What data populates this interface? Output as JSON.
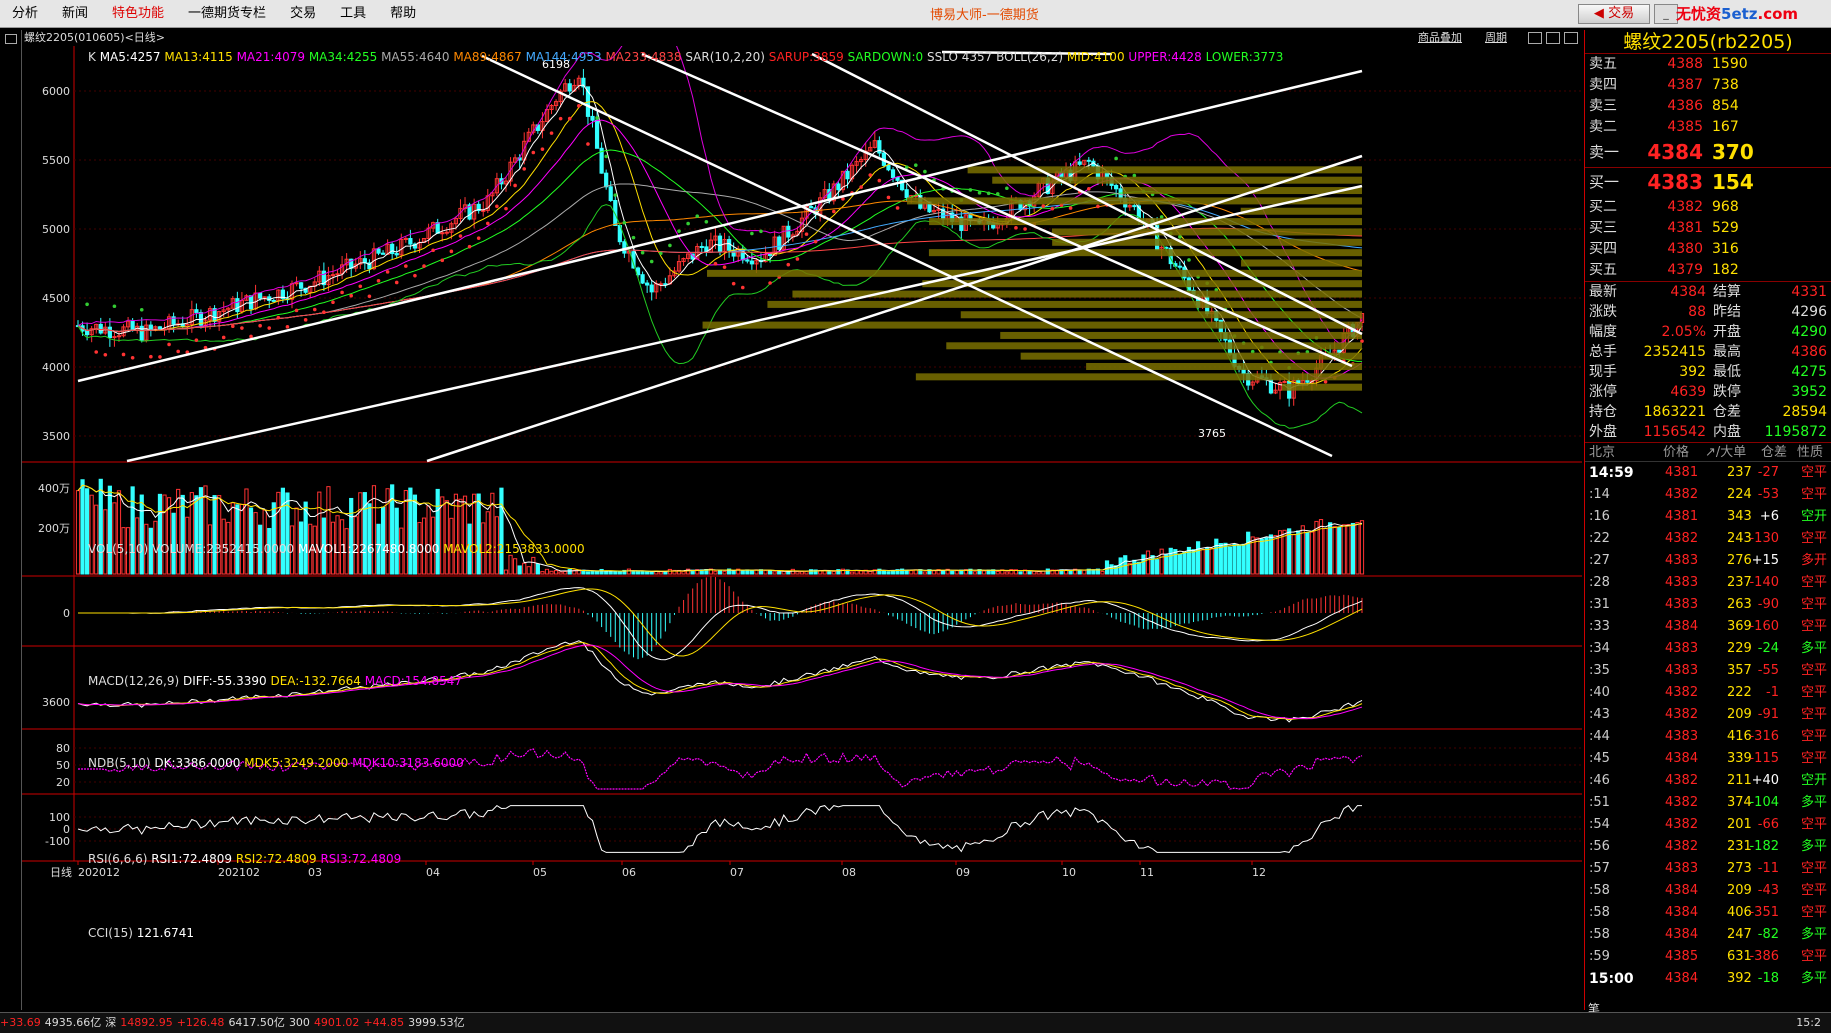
{
  "menu": {
    "items": [
      "分析",
      "新闻",
      "特色功能",
      "一德期货专栏",
      "交易",
      "工具",
      "帮助"
    ],
    "active_index": 2,
    "title": "博易大师-一德期货",
    "trade_button": "交易",
    "logo_red": "无忧资",
    "logo_blue": "5etz",
    "logo_tail": ".com"
  },
  "chart_header": {
    "symbol": "螺纹2205(010605)<日线>",
    "overlay_btn": "商品叠加",
    "period_btn": "周期"
  },
  "main_indicators": {
    "k": "K",
    "ma5": "MA5:4257",
    "ma13": "MA13:4115",
    "ma21": "MA21:4079",
    "ma34": "MA34:4255",
    "ma55": "MA55:4640",
    "ma89": "MA89:4867",
    "ma144": "MA144:4953",
    "ma233": "MA233:4838",
    "sar": "SAR(10,2,20)",
    "sarup": "SARUP:3859",
    "sardown": "SARDOWN:0",
    "sslo": "SSLO 4357",
    "boll": "BOLL(26,2)",
    "mid": "MID:4100",
    "upper": "UPPER:4428",
    "lower": "LOWER:3773"
  },
  "price_axis": [
    "6000",
    "5500",
    "5000",
    "4500",
    "4000",
    "3500"
  ],
  "annotations": {
    "high": "6198",
    "low": "3765"
  },
  "vol_panel": {
    "title": "VOL(5,10)",
    "volume": "VOLUME:2352415.0000",
    "mavol1": "MAVOL1:2267480.8000",
    "mavol2": "MAVOL2:2153833.0000",
    "axis": [
      "400万",
      "200万"
    ]
  },
  "macd_panel": {
    "title": "MACD(12,26,9)",
    "diff": "DIFF:-55.3390",
    "dea": "DEA:-132.7664",
    "macd": "MACD:154.8547",
    "axis": [
      "0"
    ]
  },
  "ndb_panel": {
    "title": "NDB(5,10)",
    "dk": "DK:3386.0000",
    "mdk5": "MDK5:3249.2000",
    "mdk10": "MDK10:3183.6000",
    "axis": [
      "3600"
    ]
  },
  "rsi_panel": {
    "title": "RSI(6,6,6)",
    "rsi1": "RSI1:72.4809",
    "rsi2": "RSI2:72.4809",
    "rsi3": "RSI3:72.4809",
    "axis": [
      "80",
      "50",
      "20"
    ]
  },
  "cci_panel": {
    "title": "CCI(15)",
    "value": "121.6741",
    "axis": [
      "100",
      "0",
      "-100"
    ]
  },
  "x_axis": {
    "label": "日线",
    "ticks": [
      "202012",
      "202102",
      "03",
      "04",
      "05",
      "06",
      "07",
      "08",
      "09",
      "10",
      "11",
      "12"
    ]
  },
  "quote": {
    "title": "螺纹2205(rb2205)",
    "asks": [
      {
        "label": "卖五",
        "price": "4388",
        "vol": "1590"
      },
      {
        "label": "卖四",
        "price": "4387",
        "vol": "738"
      },
      {
        "label": "卖三",
        "price": "4386",
        "vol": "854"
      },
      {
        "label": "卖二",
        "price": "4385",
        "vol": "167"
      },
      {
        "label": "卖一",
        "price": "4384",
        "vol": "370"
      }
    ],
    "bids": [
      {
        "label": "买一",
        "price": "4383",
        "vol": "154"
      },
      {
        "label": "买二",
        "price": "4382",
        "vol": "968"
      },
      {
        "label": "买三",
        "price": "4381",
        "vol": "529"
      },
      {
        "label": "买四",
        "price": "4380",
        "vol": "316"
      },
      {
        "label": "买五",
        "price": "4379",
        "vol": "182"
      }
    ],
    "stats": [
      {
        "l1": "最新",
        "v1": "4384",
        "l2": "结算",
        "v2": "4331",
        "c2": ""
      },
      {
        "l1": "涨跌",
        "v1": "88",
        "l2": "昨结",
        "v2": "4296",
        "c2": "w"
      },
      {
        "l1": "幅度",
        "v1": "2.05%",
        "l2": "开盘",
        "v2": "4290",
        "c2": "g"
      },
      {
        "l1": "总手",
        "v1": "2352415",
        "v1c": "y",
        "l2": "最高",
        "v2": "4386",
        "c2": ""
      },
      {
        "l1": "现手",
        "v1": "392",
        "v1c": "y",
        "l2": "最低",
        "v2": "4275",
        "c2": "g"
      },
      {
        "l1": "涨停",
        "v1": "4639",
        "l2": "跌停",
        "v2": "3952",
        "c2": "g"
      },
      {
        "l1": "持仓",
        "v1": "1863221",
        "v1c": "y",
        "l2": "仓差",
        "v2": "28594",
        "c2": "y"
      },
      {
        "l1": "外盘",
        "v1": "1156542",
        "l2": "内盘",
        "v2": "1195872",
        "c2": "g"
      }
    ],
    "tick_header": {
      "loc": "北京",
      "price": "价格",
      "vol": "↗/大单",
      "diff": "仓差",
      "nature": "性质"
    },
    "ticks": [
      {
        "t": "14:59",
        "p": "4381",
        "v": "237",
        "d": "-27",
        "dc": "",
        "n": "空平",
        "nc": "",
        "b": true
      },
      {
        "t": ":14",
        "p": "4382",
        "v": "224",
        "d": "-53",
        "dc": "",
        "n": "空平",
        "nc": ""
      },
      {
        "t": ":16",
        "p": "4381",
        "v": "343",
        "d": "+6",
        "dc": "w",
        "n": "空开",
        "nc": "g"
      },
      {
        "t": ":22",
        "p": "4382",
        "v": "243",
        "d": "-130",
        "dc": "",
        "n": "空平",
        "nc": ""
      },
      {
        "t": ":27",
        "p": "4383",
        "v": "276",
        "d": "+15",
        "dc": "w",
        "n": "多开",
        "nc": ""
      },
      {
        "t": ":28",
        "p": "4383",
        "v": "237",
        "d": "-140",
        "dc": "",
        "n": "空平",
        "nc": ""
      },
      {
        "t": ":31",
        "p": "4383",
        "v": "263",
        "d": "-90",
        "dc": "",
        "n": "空平",
        "nc": ""
      },
      {
        "t": ":33",
        "p": "4384",
        "v": "369",
        "d": "-160",
        "dc": "",
        "n": "空平",
        "nc": ""
      },
      {
        "t": ":34",
        "p": "4383",
        "v": "229",
        "d": "-24",
        "dc": "g",
        "n": "多平",
        "nc": "g"
      },
      {
        "t": ":35",
        "p": "4383",
        "v": "357",
        "d": "-55",
        "dc": "",
        "n": "空平",
        "nc": ""
      },
      {
        "t": ":40",
        "p": "4382",
        "v": "222",
        "d": "-1",
        "dc": "",
        "n": "空平",
        "nc": ""
      },
      {
        "t": ":43",
        "p": "4382",
        "v": "209",
        "d": "-91",
        "dc": "",
        "n": "空平",
        "nc": ""
      },
      {
        "t": ":44",
        "p": "4383",
        "v": "416",
        "d": "-316",
        "dc": "",
        "n": "空平",
        "nc": ""
      },
      {
        "t": ":45",
        "p": "4384",
        "v": "339",
        "d": "-115",
        "dc": "",
        "n": "空平",
        "nc": ""
      },
      {
        "t": ":46",
        "p": "4382",
        "v": "211",
        "d": "+40",
        "dc": "w",
        "n": "空开",
        "nc": "g"
      },
      {
        "t": ":51",
        "p": "4382",
        "v": "374",
        "d": "-104",
        "dc": "g",
        "n": "多平",
        "nc": "g"
      },
      {
        "t": ":54",
        "p": "4382",
        "v": "201",
        "d": "-66",
        "dc": "",
        "n": "空平",
        "nc": ""
      },
      {
        "t": ":56",
        "p": "4382",
        "v": "231",
        "d": "-182",
        "dc": "g",
        "n": "多平",
        "nc": "g"
      },
      {
        "t": ":57",
        "p": "4383",
        "v": "273",
        "d": "-11",
        "dc": "",
        "n": "空平",
        "nc": ""
      },
      {
        "t": ":58",
        "p": "4384",
        "v": "209",
        "d": "-43",
        "dc": "",
        "n": "空平",
        "nc": ""
      },
      {
        "t": ":58",
        "p": "4384",
        "v": "406",
        "d": "-351",
        "dc": "",
        "n": "空平",
        "nc": ""
      },
      {
        "t": ":58",
        "p": "4384",
        "v": "247",
        "d": "-82",
        "dc": "g",
        "n": "多平",
        "nc": "g"
      },
      {
        "t": ":59",
        "p": "4385",
        "v": "631",
        "d": "-386",
        "dc": "",
        "n": "空平",
        "nc": ""
      },
      {
        "t": "15:00",
        "p": "4384",
        "v": "392",
        "d": "-18",
        "dc": "g",
        "n": "多平",
        "nc": "g",
        "b": true
      }
    ],
    "bottom_tab": "笔"
  },
  "statusbar": [
    {
      "text": "+33.69",
      "c": ""
    },
    {
      "text": "4935.66亿",
      "c": "w"
    },
    {
      "text": "深",
      "c": "w"
    },
    {
      "text": "14892.95",
      "c": ""
    },
    {
      "text": "+126.48",
      "c": ""
    },
    {
      "text": "6417.50亿",
      "c": "w"
    },
    {
      "text": "300",
      "c": "w"
    },
    {
      "text": "4901.02",
      "c": ""
    },
    {
      "text": "+44.85",
      "c": ""
    },
    {
      "text": "3999.53亿",
      "c": "w"
    }
  ],
  "status_time": "15:2"
}
